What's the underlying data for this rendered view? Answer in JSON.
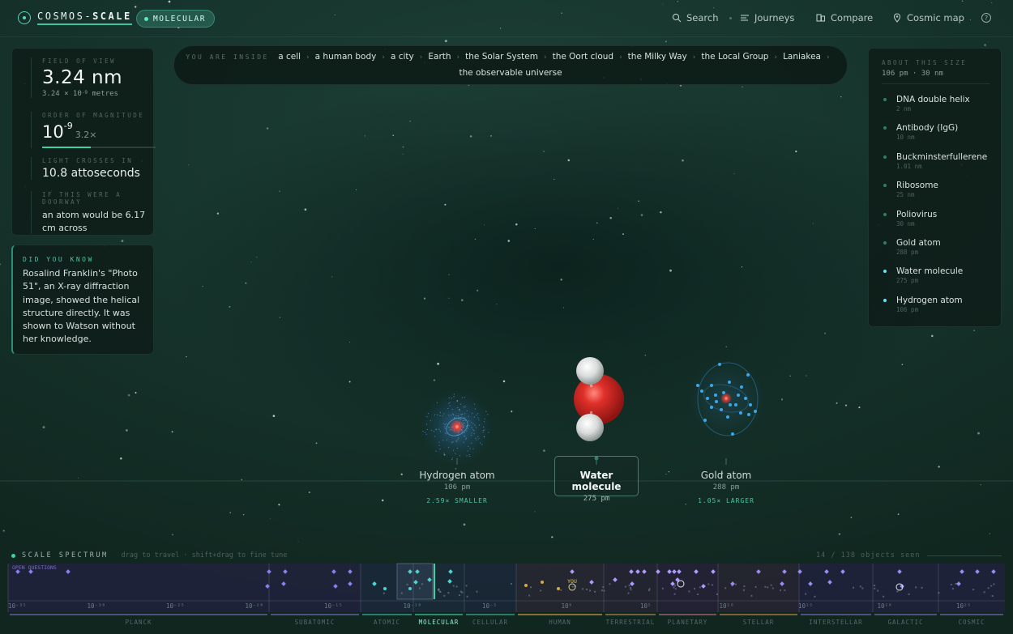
{
  "brand": {
    "name_light": "COSMOS-",
    "name_bold": "SCALE",
    "mode_badge": "MOLECULAR"
  },
  "nav": [
    {
      "label": "Search",
      "icon": "search-icon"
    },
    {
      "label": "Journeys",
      "icon": "list-icon"
    },
    {
      "label": "Compare",
      "icon": "compare-icon"
    },
    {
      "label": "Cosmic map",
      "icon": "map-pin-icon"
    }
  ],
  "breadcrumb": {
    "prefix": "YOU ARE INSIDE",
    "items": [
      "a cell",
      "a human body",
      "a city",
      "Earth",
      "the Solar System",
      "the Oort cloud",
      "the Milky Way",
      "the Local Group",
      "Laniakea",
      "the observable universe"
    ]
  },
  "stats": {
    "fov_label": "FIELD OF VIEW",
    "fov_value": "3.24 nm",
    "fov_mantissa": "3.24 × 10",
    "fov_exp": "-9",
    "fov_unit": "metres",
    "oom_label": "ORDER OF MAGNITUDE",
    "oom_base": "10",
    "oom_exp": "-9",
    "oom_mult": "3.2×",
    "oom_fill": 0.43,
    "light_label": "LIGHT CROSSES IN",
    "light_value": "10.8 attoseconds",
    "doorway_label": "IF THIS WERE A DOORWAY",
    "doorway_text": "an atom would be 6.17 cm across"
  },
  "did_you_know": {
    "label": "DID YOU KNOW",
    "text": "Rosalind Franklin's \"Photo 51\", an X-ray diffraction image, showed the helical structure directly. It was shown to Watson without her knowledge."
  },
  "about": {
    "label": "ABOUT THIS SIZE",
    "range": "106 pm · 30 nm",
    "items": [
      {
        "name": "DNA double helix",
        "size": "2 nm",
        "active": false
      },
      {
        "name": "Antibody (IgG)",
        "size": "10 nm",
        "active": false
      },
      {
        "name": "Buckminsterfullerene",
        "size": "1.01 nm",
        "active": false
      },
      {
        "name": "Ribosome",
        "size": "25 nm",
        "active": false
      },
      {
        "name": "Poliovirus",
        "size": "30 nm",
        "active": false
      },
      {
        "name": "Gold atom",
        "size": "288 pm",
        "active": false
      },
      {
        "name": "Water molecule",
        "size": "275 pm",
        "active": true
      },
      {
        "name": "Hydrogen atom",
        "size": "106 pm",
        "active": true
      }
    ]
  },
  "scene": {
    "left": {
      "name": "Hydrogen atom",
      "size": "106 pm",
      "compare": "2.59× SMALLER"
    },
    "center": {
      "name": "Water molecule",
      "size": "275 pm"
    },
    "right": {
      "name": "Gold atom",
      "size": "288 pm",
      "compare": "1.05× LARGER"
    }
  },
  "spectrum": {
    "title": "SCALE SPECTRUM",
    "hint": "drag to travel · shift+drag to fine tune",
    "count": "14 / 138 objects seen",
    "open_questions": "OPEN QUESTIONS",
    "you_label": "YOU",
    "ticks": [
      "10⁻³⁵",
      "10⁻³⁰",
      "10⁻²⁵",
      "10⁻²⁰",
      "10⁻¹⁵",
      "10⁻¹⁰",
      "10⁻⁵",
      "10⁰",
      "10⁵",
      "10¹⁰",
      "10¹⁵",
      "10²⁰",
      "10²⁵"
    ],
    "bands": [
      {
        "label": "PLANCK",
        "color": "#7c6cc4"
      },
      {
        "label": "SUBATOMIC",
        "color": "#7c6cc4"
      },
      {
        "label": "ATOMIC",
        "color": "#3bb8b0"
      },
      {
        "label": "MOLECULAR",
        "color": "#3fd0a8"
      },
      {
        "label": "CELLULAR",
        "color": "#3fb0a0"
      },
      {
        "label": "HUMAN",
        "color": "#d7a64a"
      },
      {
        "label": "TERRESTRIAL",
        "color": "#b98a52"
      },
      {
        "label": "PLANETARY",
        "color": "#c06a8a"
      },
      {
        "label": "STELLAR",
        "color": "#c98b4a"
      },
      {
        "label": "INTERSTELLAR",
        "color": "#7a6bc0"
      },
      {
        "label": "GALACTIC",
        "color": "#7a6bc0"
      },
      {
        "label": "COSMIC",
        "color": "#7a6bc0"
      }
    ]
  },
  "colors": {
    "accent": "#3fd0a8",
    "oxygen": "#d8312c",
    "electron": "#3aa8e8"
  }
}
